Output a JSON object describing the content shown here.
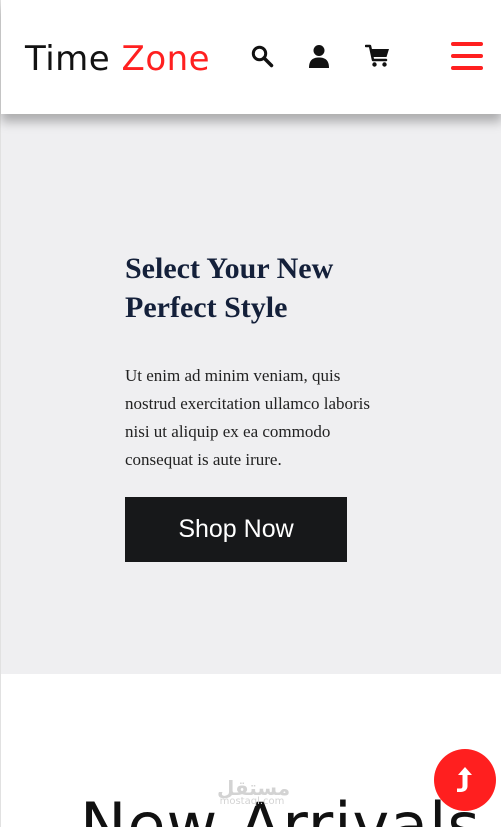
{
  "header": {
    "logo_part1": "Time",
    "logo_part2": "Zone",
    "icons": [
      "search-icon",
      "user-icon",
      "cart-icon",
      "menu-icon"
    ]
  },
  "hero": {
    "title": "Select Your New Perfect Style",
    "text": "Ut enim ad minim veniam, quis nostrud exercitation ullamco laboris nisi ut aliquip ex ea commodo consequat is aute irure.",
    "button_label": "Shop Now"
  },
  "arrivals": {
    "title": "New Arrivals"
  },
  "watermark": {
    "arabic": "مستقل",
    "latin": "mostaql.com"
  },
  "scroll_top": {
    "icon": "arrow-up-icon"
  },
  "colors": {
    "accent": "#ff2020",
    "hero_background": "#efeff1",
    "heading": "#14203a",
    "button": "#17181a"
  }
}
